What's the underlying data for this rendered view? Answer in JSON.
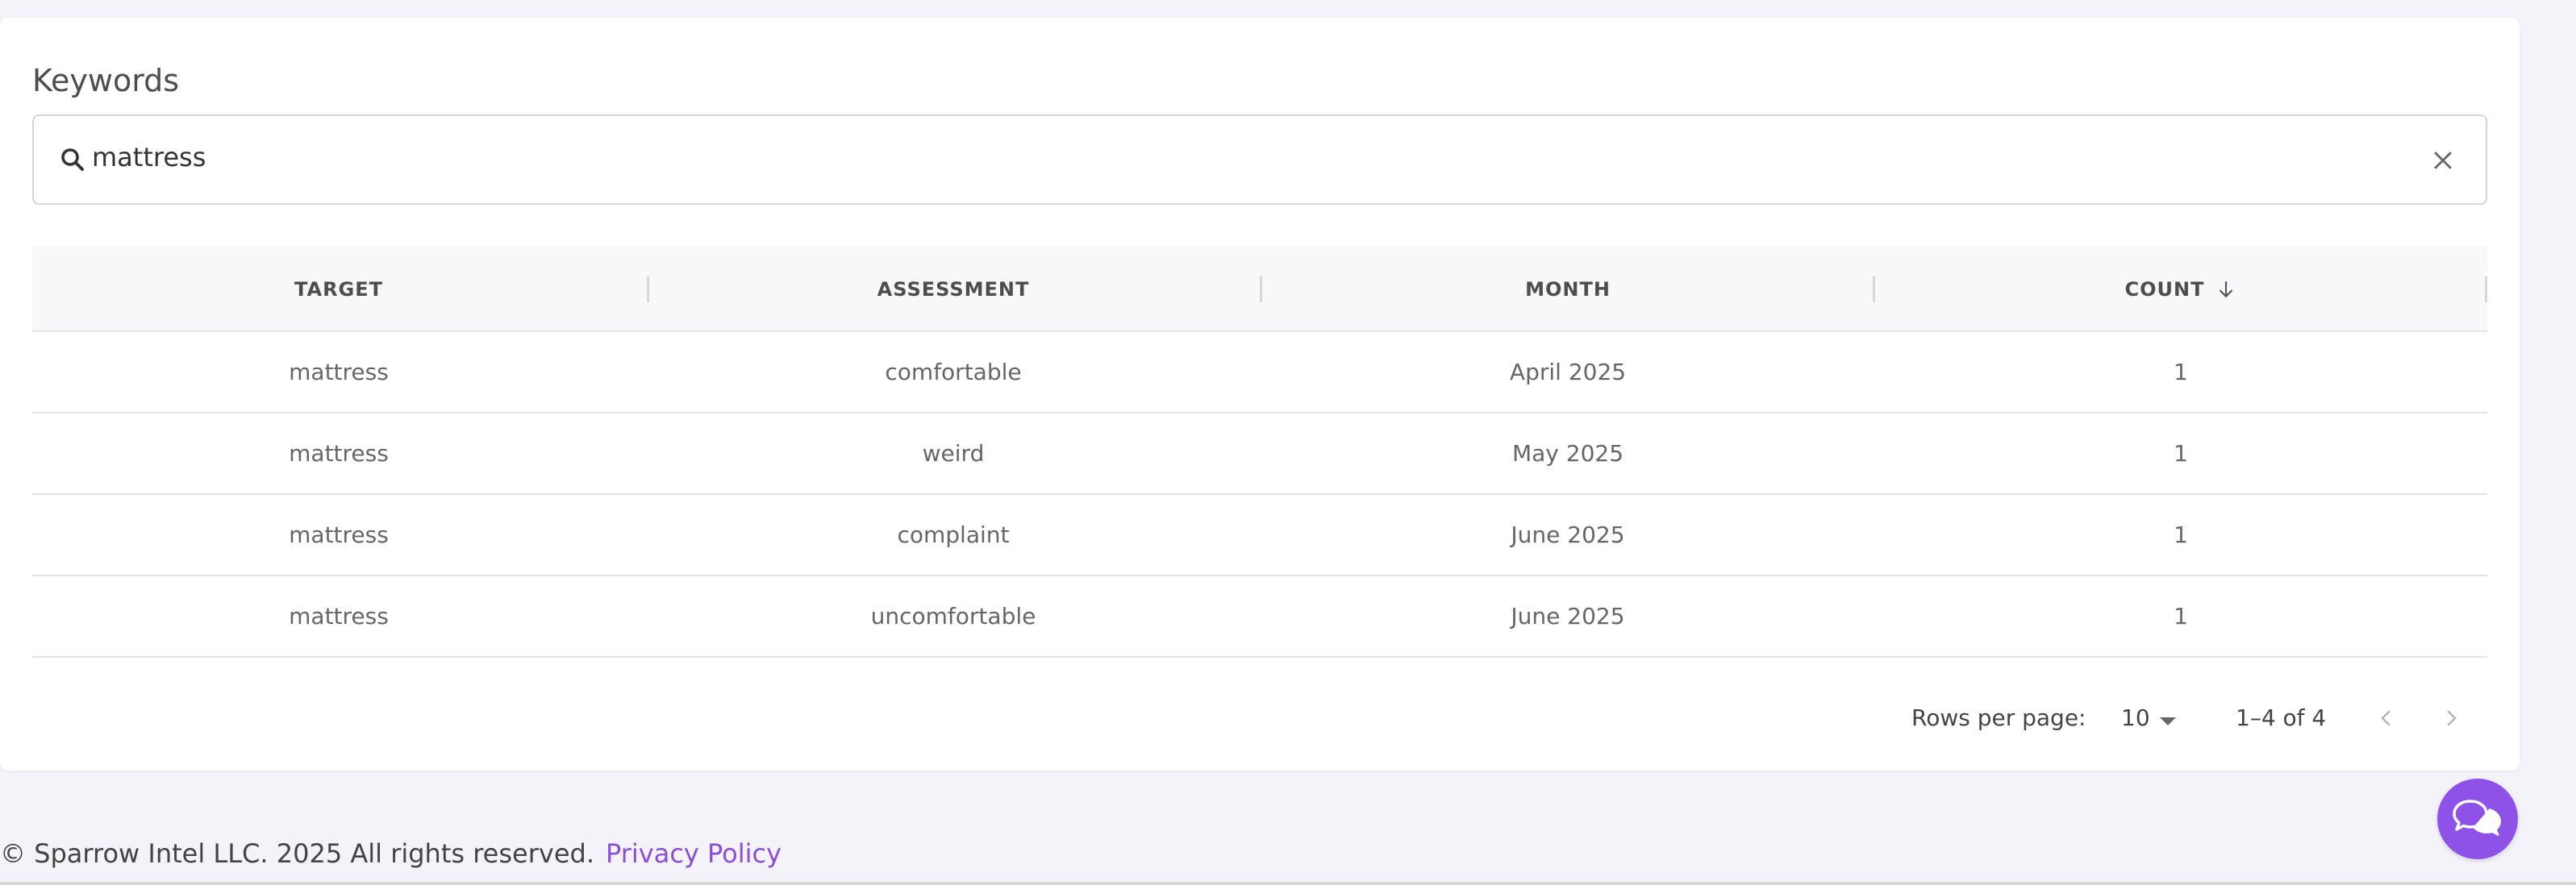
{
  "card": {
    "title": "Keywords"
  },
  "search": {
    "value": "mattress"
  },
  "table": {
    "columns": [
      "TARGET",
      "ASSESSMENT",
      "MONTH",
      "COUNT"
    ],
    "rows": [
      [
        "mattress",
        "comfortable",
        "April 2025",
        "1"
      ],
      [
        "mattress",
        "weird",
        "May 2025",
        "1"
      ],
      [
        "mattress",
        "complaint",
        "June 2025",
        "1"
      ],
      [
        "mattress",
        "uncomfortable",
        "June 2025",
        "1"
      ]
    ]
  },
  "pagination": {
    "rows_per_page_label": "Rows per page:",
    "rows_per_page_value": "10",
    "range": "1–4 of 4"
  },
  "footer": {
    "copyright": "© Sparrow Intel LLC. 2025 All rights reserved.",
    "privacy_link": "Privacy Policy"
  },
  "colors": {
    "accent": "#8f52e8",
    "link": "#8a4fd6"
  },
  "icons": [
    "search-icon",
    "close-icon",
    "arrow-down-icon",
    "caret-down-icon",
    "chevron-left-icon",
    "chevron-right-icon",
    "chat-icon"
  ]
}
